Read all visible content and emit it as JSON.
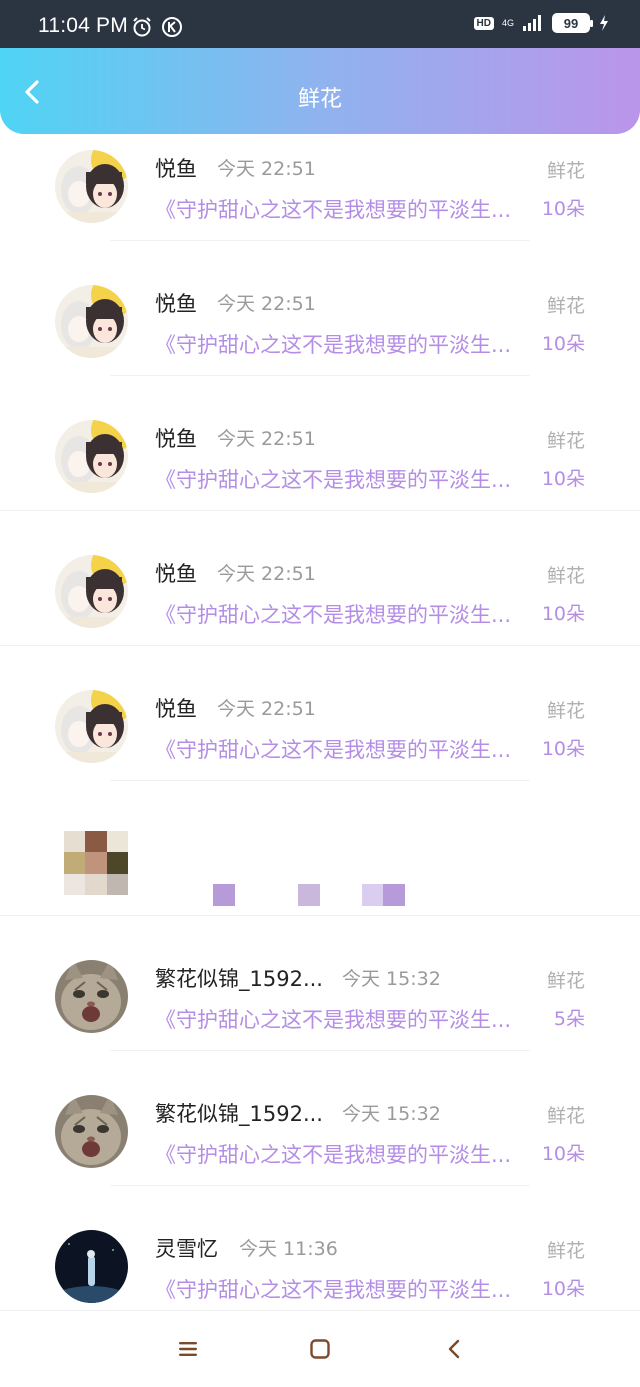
{
  "status_bar": {
    "time": "11:04 PM",
    "hd": "HD",
    "network": "4G",
    "battery": "99"
  },
  "header": {
    "title": "鲜花"
  },
  "rows": [
    {
      "name": "悦鱼",
      "time": "今天 22:51",
      "book": "《守护甜心之这不是我想要的平淡生...",
      "gift": "鲜花",
      "count": "10朵"
    },
    {
      "name": "悦鱼",
      "time": "今天 22:51",
      "book": "《守护甜心之这不是我想要的平淡生...",
      "gift": "鲜花",
      "count": "10朵"
    },
    {
      "name": "悦鱼",
      "time": "今天 22:51",
      "book": "《守护甜心之这不是我想要的平淡生...",
      "gift": "鲜花",
      "count": "10朵"
    },
    {
      "name": "悦鱼",
      "time": "今天 22:51",
      "book": "《守护甜心之这不是我想要的平淡生...",
      "gift": "鲜花",
      "count": "10朵"
    },
    {
      "name": "悦鱼",
      "time": "今天 22:51",
      "book": "《守护甜心之这不是我想要的平淡生...",
      "gift": "鲜花",
      "count": "10朵"
    },
    {
      "name": "繁花似锦_1592...",
      "time": "今天 15:32",
      "book": "《守护甜心之这不是我想要的平淡生...",
      "gift": "鲜花",
      "count": "5朵"
    },
    {
      "name": "繁花似锦_1592...",
      "time": "今天 15:32",
      "book": "《守护甜心之这不是我想要的平淡生...",
      "gift": "鲜花",
      "count": "10朵"
    },
    {
      "name": "灵雪忆",
      "time": "今天 11:36",
      "book": "《守护甜心之这不是我想要的平淡生...",
      "gift": "鲜花",
      "count": "10朵"
    }
  ],
  "colors": {
    "accent_purple": "#b48ee6",
    "header_gradient_start": "#4fd4f4",
    "header_gradient_end": "#bb95ea",
    "status_bar": "#2b3441"
  },
  "nav": {
    "icons": [
      "menu-icon",
      "home-square-icon",
      "back-chevron-icon"
    ]
  }
}
